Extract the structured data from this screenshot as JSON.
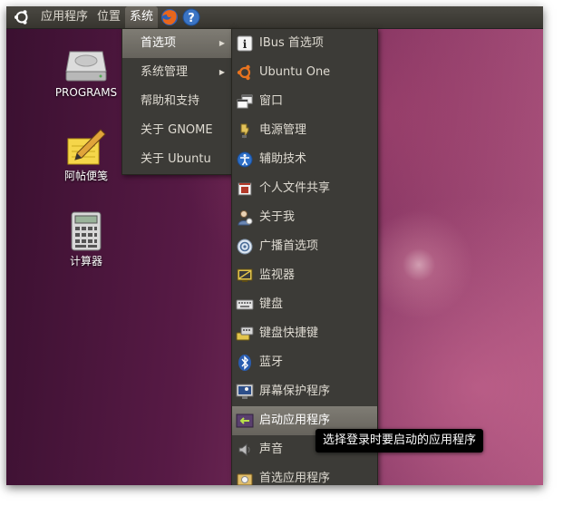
{
  "panel": {
    "menus": [
      "应用程序",
      "位置",
      "系统"
    ]
  },
  "desktop": {
    "icons": [
      {
        "label": "PROGRAMS",
        "icon": "hard-drive-icon"
      },
      {
        "label": "阿帖便笺",
        "icon": "notepad-pencil-icon"
      },
      {
        "label": "计算器",
        "icon": "calculator-icon"
      }
    ]
  },
  "system_menu": {
    "items": [
      "首选项",
      "系统管理",
      "帮助和支持",
      "关于 GNOME",
      "关于 Ubuntu"
    ]
  },
  "preferences_menu": {
    "items": [
      "IBus 首选项",
      "Ubuntu One",
      "窗口",
      "电源管理",
      "辅助技术",
      "个人文件共享",
      "关于我",
      "广播首选项",
      "监视器",
      "键盘",
      "键盘快捷键",
      "蓝牙",
      "屏幕保护程序",
      "启动应用程序",
      "声音",
      "首选应用程序"
    ]
  },
  "tooltip": {
    "text": "选择登录时要启动的应用程序"
  }
}
